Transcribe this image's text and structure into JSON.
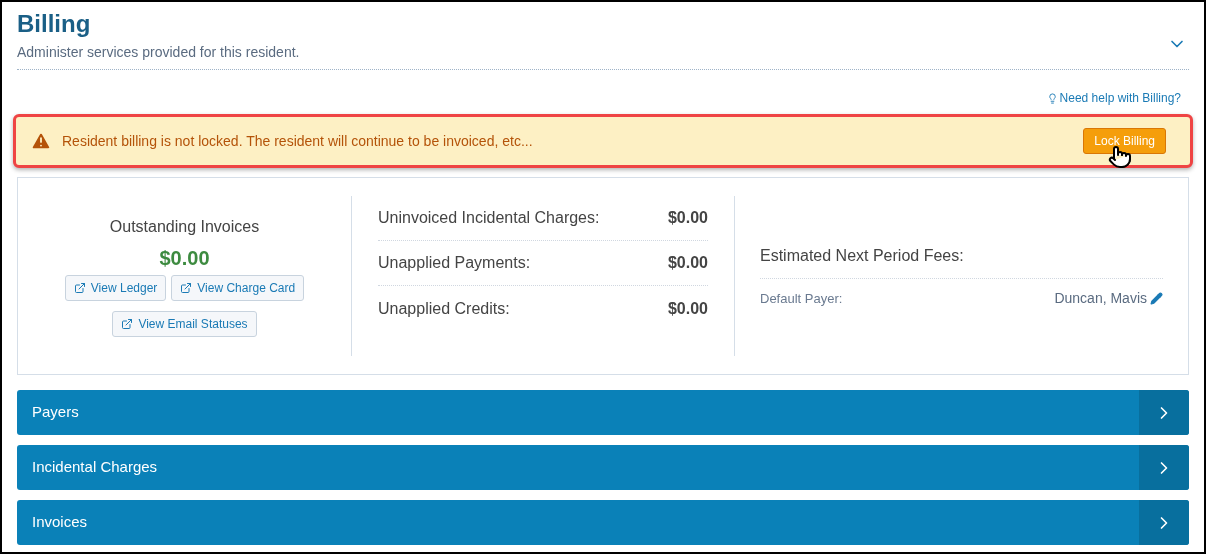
{
  "header": {
    "title": "Billing",
    "subtitle": "Administer services provided for this resident.",
    "expanded": true
  },
  "help_link": "Need help with Billing?",
  "alert": {
    "message": "Resident billing is not locked. The resident will continue to be invoiced, etc...",
    "button": "Lock Billing"
  },
  "summary": {
    "outstanding": {
      "label": "Outstanding Invoices",
      "amount": "$0.00",
      "buttons": [
        "View Ledger",
        "View Charge Card",
        "View Email Statuses"
      ]
    },
    "balances": [
      {
        "label": "Uninvoiced Incidental Charges:",
        "value": "$0.00"
      },
      {
        "label": "Unapplied Payments:",
        "value": "$0.00"
      },
      {
        "label": "Unapplied Credits:",
        "value": "$0.00"
      }
    ],
    "fees": {
      "label": "Estimated Next Period Fees:",
      "payer_label": "Default Payer:",
      "payer": "Duncan, Mavis"
    }
  },
  "sections": [
    {
      "label": "Payers",
      "expanded": false
    },
    {
      "label": "Incidental Charges",
      "expanded": false
    },
    {
      "label": "Invoices",
      "expanded": false
    }
  ]
}
